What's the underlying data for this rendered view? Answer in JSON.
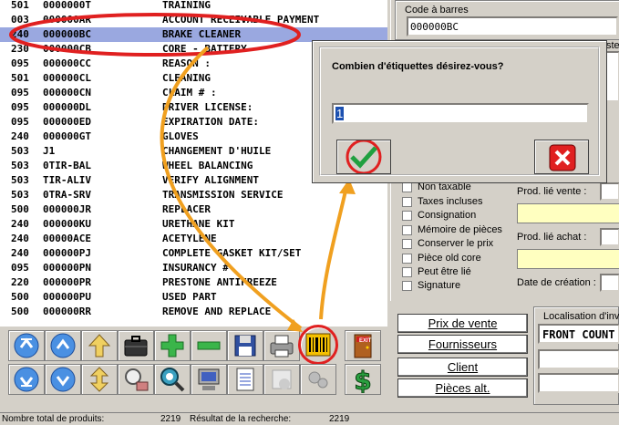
{
  "products": [
    {
      "dept": "501",
      "code": "0000000T",
      "desc": "TRAINING",
      "selected": false
    },
    {
      "dept": "003",
      "code": "000000AR",
      "desc": "ACCOUNT RECEIVABLE PAYMENT",
      "selected": false
    },
    {
      "dept": "240",
      "code": "000000BC",
      "desc": "BRAKE CLEANER",
      "selected": true
    },
    {
      "dept": "230",
      "code": "000000CB",
      "desc": "CORE - BATTERY",
      "selected": false
    },
    {
      "dept": "095",
      "code": "000000CC",
      "desc": "REASON :",
      "selected": false
    },
    {
      "dept": "501",
      "code": "000000CL",
      "desc": "CLEANING",
      "selected": false
    },
    {
      "dept": "095",
      "code": "000000CN",
      "desc": "CLAIM # :",
      "selected": false
    },
    {
      "dept": "095",
      "code": "000000DL",
      "desc": "DRIVER LICENSE:",
      "selected": false
    },
    {
      "dept": "095",
      "code": "000000ED",
      "desc": "EXPIRATION DATE:",
      "selected": false
    },
    {
      "dept": "240",
      "code": "000000GT",
      "desc": "GLOVES",
      "selected": false
    },
    {
      "dept": "503",
      "code": "J1",
      "desc": "CHANGEMENT D'HUILE",
      "selected": false
    },
    {
      "dept": "503",
      "code": "0TIR-BAL",
      "desc": "WHEEL BALANCING",
      "selected": false
    },
    {
      "dept": "503",
      "code": "TIR-ALIV",
      "desc": "VERIFY ALIGNMENT",
      "selected": false
    },
    {
      "dept": "503",
      "code": "0TRA-SRV",
      "desc": "TRANSMISSION SERVICE",
      "selected": false
    },
    {
      "dept": "500",
      "code": "000000JR",
      "desc": "REPLACER",
      "selected": false
    },
    {
      "dept": "240",
      "code": "000000KU",
      "desc": "URETHANE KIT",
      "selected": false
    },
    {
      "dept": "240",
      "code": "00000ACE",
      "desc": "ACETYLENE",
      "selected": false
    },
    {
      "dept": "240",
      "code": "000000PJ",
      "desc": "COMPLETE GASKET KIT/SET",
      "selected": false
    },
    {
      "dept": "095",
      "code": "000000PN",
      "desc": "INSURANCY #",
      "selected": false
    },
    {
      "dept": "220",
      "code": "000000PR",
      "desc": "PRESTONE ANTIFREEZE",
      "selected": false
    },
    {
      "dept": "500",
      "code": "000000PU",
      "desc": "USED PART",
      "selected": false
    },
    {
      "dept": "500",
      "code": "000000RR",
      "desc": "REMOVE AND REPLACE",
      "selected": false
    }
  ],
  "right_panel": {
    "barcode_label": "Code à barres",
    "barcode_value": "000000BC",
    "partial_label": "ste",
    "checkboxes": [
      "Non taxable",
      "Taxes incluses",
      "Consignation",
      "Mémoire de pièces",
      "Conserver le prix",
      "Pièce old core",
      "Peut être lié",
      "Signature"
    ],
    "linked_sale_label": "Prod. lié vente :",
    "linked_purchase_label": "Prod. lié achat :",
    "creation_date_label": "Date de création :"
  },
  "dialog": {
    "question": "Combien d'étiquettes désirez-vous?",
    "quantity": "1"
  },
  "bottom_buttons": {
    "prix": "Prix de vente",
    "fournisseurs": "Fournisseurs",
    "client": "Client",
    "pieces": "Pièces alt."
  },
  "location": {
    "label": "Localisation d'inve",
    "value": "FRONT COUNT"
  },
  "toolbar": {
    "exit_label": "EXIT"
  },
  "status": {
    "total_label": "Nombre total de produits:",
    "total_value": "2219",
    "result_label": "Résultat de la recherche:",
    "result_value": "2219"
  }
}
